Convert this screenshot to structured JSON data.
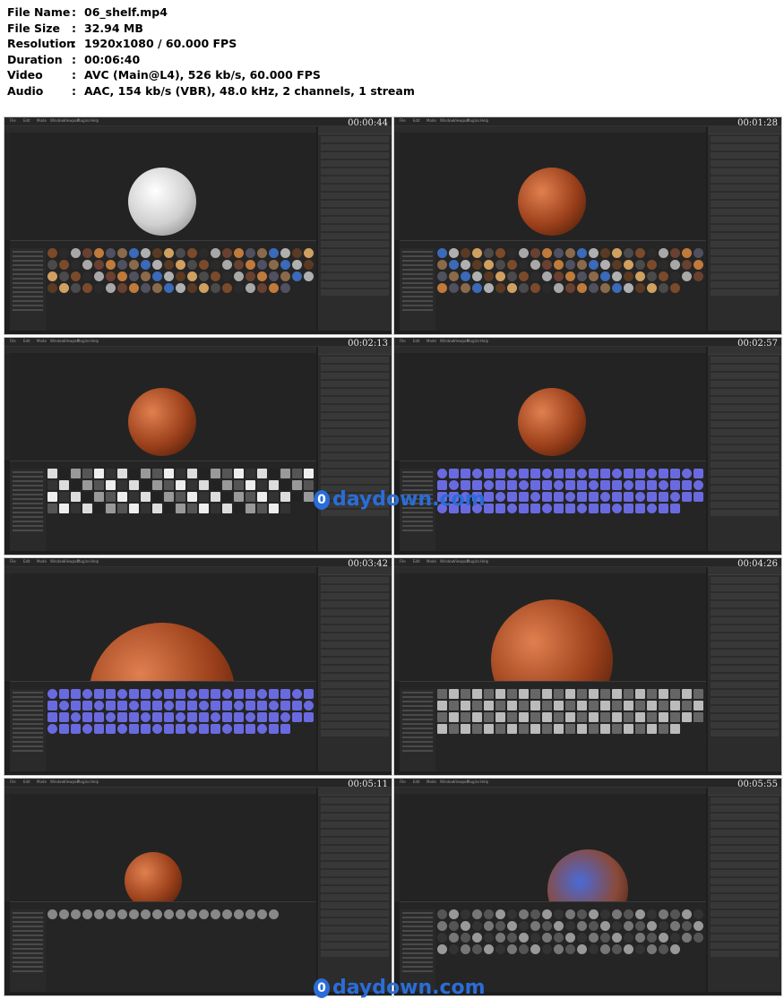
{
  "info": [
    {
      "label": "File Name",
      "value": "06_shelf.mp4"
    },
    {
      "label": "File Size",
      "value": "32.94 MB"
    },
    {
      "label": "Resolution",
      "value": "1920x1080 / 60.000 FPS"
    },
    {
      "label": "Duration",
      "value": "00:06:40"
    },
    {
      "label": "Video",
      "value": "AVC (Main@L4), 526 kb/s, 60.000 FPS"
    },
    {
      "label": "Audio",
      "value": "AAC, 154 kb/s (VBR), 48.0 kHz, 2 channels, 1 stream"
    }
  ],
  "separator": ":",
  "menu": [
    "File",
    "Edit",
    "Mode",
    "Window",
    "Viewport",
    "Plugins",
    "Help"
  ],
  "thumbs": [
    {
      "time": "00:00:44",
      "sphere": "white",
      "shelf": "materials"
    },
    {
      "time": "00:01:28",
      "sphere": "copper",
      "shelf": "materials"
    },
    {
      "time": "00:02:13",
      "sphere": "copper",
      "shelf": "patterns"
    },
    {
      "time": "00:02:57",
      "sphere": "copper",
      "shelf": "shapes"
    },
    {
      "time": "00:03:42",
      "sphere": "copper-large",
      "shelf": "shapes"
    },
    {
      "time": "00:04:26",
      "sphere": "copper-face",
      "shelf": "brushes"
    },
    {
      "time": "00:05:11",
      "sphere": "copper-small",
      "shelf": "particles"
    },
    {
      "time": "00:05:55",
      "sphere": "copper-blue",
      "shelf": "alphas"
    }
  ],
  "watermark": "daydown.com",
  "watermark_icon": "0",
  "colors": {
    "copper": "#b5552a",
    "white": "#d9d9d9",
    "accent": "#2a6dd8"
  }
}
